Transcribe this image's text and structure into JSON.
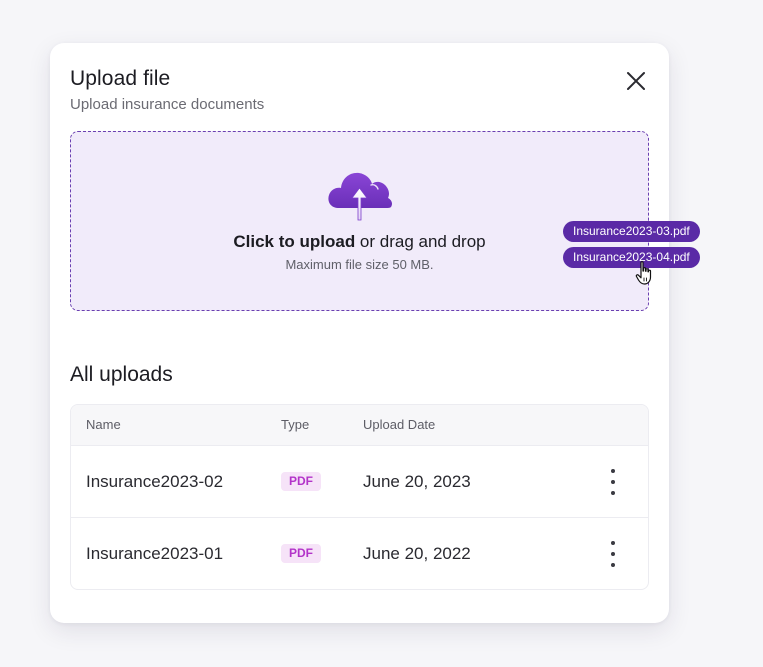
{
  "modal": {
    "title": "Upload file",
    "subtitle": "Upload insurance documents",
    "close_icon": "close-icon"
  },
  "dropzone": {
    "icon": "cloud-upload-icon",
    "cta_bold": "Click to upload",
    "cta_rest": " or drag and drop",
    "hint": "Maximum file size 50 MB."
  },
  "dragged_files": [
    "Insurance2023-03.pdf",
    "Insurance2023-04.pdf"
  ],
  "uploads": {
    "title": "All uploads",
    "columns": [
      "Name",
      "Type",
      "Upload Date"
    ],
    "rows": [
      {
        "name": "Insurance2023-02",
        "type": "PDF",
        "date": "June 20, 2023",
        "menu_icon": "more-vertical-icon"
      },
      {
        "name": "Insurance2023-01",
        "type": "PDF",
        "date": "June 20, 2022",
        "menu_icon": "more-vertical-icon"
      }
    ]
  },
  "colors": {
    "accent": "#5a2aa6",
    "dropzone_bg": "#f1ebfa",
    "badge_text": "#b334c9",
    "badge_bg": "#f6e3f8"
  }
}
